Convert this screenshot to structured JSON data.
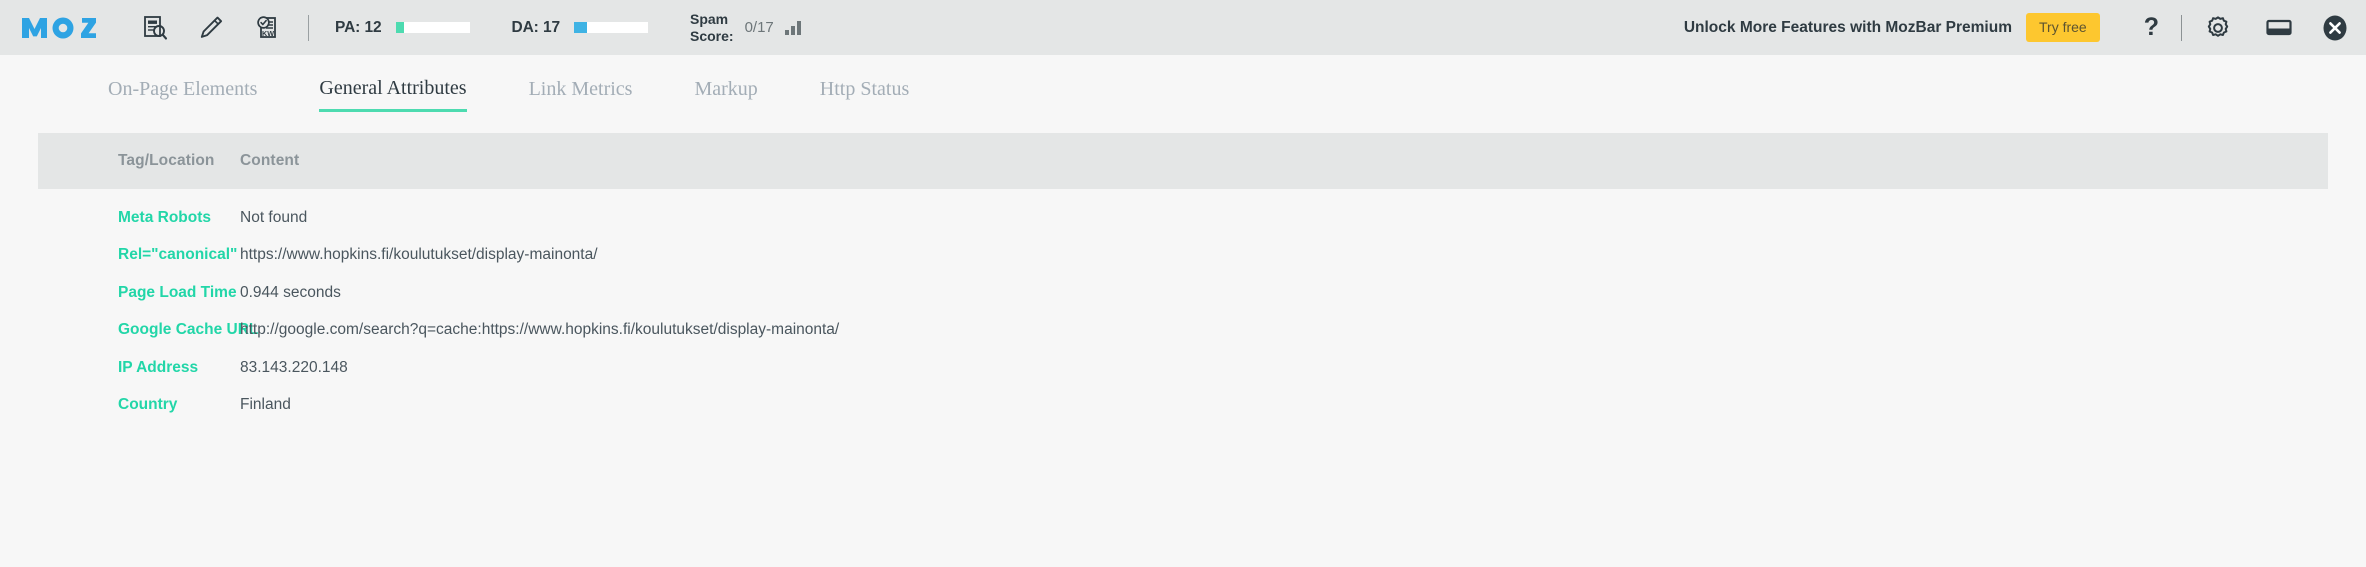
{
  "toolbar": {
    "logo_text": "moz",
    "logo_color": "#2ea3e3",
    "tools": [
      {
        "name": "page-analysis-icon",
        "title": "Page Analysis"
      },
      {
        "name": "highlighter-pencil-icon",
        "title": "Highlighter"
      },
      {
        "name": "keyword-check-icon",
        "title": "Keyword Check"
      }
    ],
    "pa": {
      "label": "PA: 12",
      "value": 12,
      "max": 100,
      "bar_color": "#4ddbb0"
    },
    "da": {
      "label": "DA: 17",
      "value": 17,
      "max": 100,
      "bar_color": "#3fb3e4"
    },
    "spam": {
      "label_line1": "Spam",
      "label_line2": "Score:",
      "score": "0/17"
    },
    "premium_text": "Unlock More Features with MozBar Premium",
    "try_free_label": "Try free",
    "try_free_color": "#fdc72f",
    "help_label": "?",
    "gear_title": "Settings",
    "minimize_title": "Minimize",
    "close_title": "Close"
  },
  "tabs": [
    {
      "label": "On-Page Elements",
      "active": false
    },
    {
      "label": "General Attributes",
      "active": true
    },
    {
      "label": "Link Metrics",
      "active": false
    },
    {
      "label": "Markup",
      "active": false
    },
    {
      "label": "Http Status",
      "active": false
    }
  ],
  "table": {
    "headers": {
      "tag": "Tag/Location",
      "content": "Content"
    },
    "accent_color": "#22d6a8",
    "rows": [
      {
        "tag": "Meta Robots",
        "content": "Not found"
      },
      {
        "tag": "Rel=\"canonical\"",
        "content": "https://www.hopkins.fi/koulutukset/display-mainonta/"
      },
      {
        "tag": "Page Load Time",
        "content": "0.944 seconds"
      },
      {
        "tag": "Google Cache URL",
        "content": "http://google.com/search?q=cache:https://www.hopkins.fi/koulutukset/display-mainonta/"
      },
      {
        "tag": "IP Address",
        "content": "83.143.220.148"
      },
      {
        "tag": "Country",
        "content": "Finland"
      }
    ]
  }
}
